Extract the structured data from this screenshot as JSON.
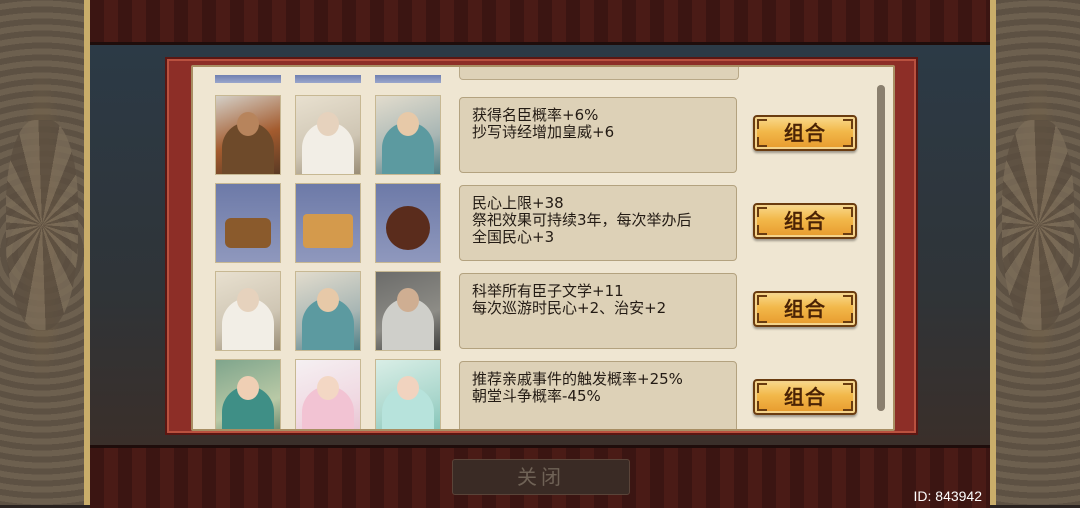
{
  "dialog": {
    "rows": [
      {
        "portraits": [
          "warrior-general-icon",
          "white-haired-sage-icon",
          "young-scholar-official-icon"
        ],
        "description": "获得名臣概率+6%\n抄写诗经增加皇威+6",
        "button": "组合"
      },
      {
        "portraits": [
          "treasure-cart-icon",
          "gold-ingots-icon",
          "wine-jar-icon"
        ],
        "description": "民心上限+38\n祭祀效果可持续3年，每次举办后\n全国民心+3",
        "button": "组合"
      },
      {
        "portraits": [
          "white-haired-sage-icon",
          "young-scholar-official-icon",
          "elder-minister-icon"
        ],
        "description": "科举所有臣子文学+11\n每次巡游时民心+2、治安+2",
        "button": "组合"
      },
      {
        "portraits": [
          "consort-lady-icon",
          "pink-dress-maiden-icon",
          "green-dress-maiden-icon"
        ],
        "description": "推荐亲戚事件的触发概率+25%\n朝堂斗争概率-45%",
        "button": "组合"
      }
    ]
  },
  "footer": {
    "close_label": "关闭",
    "id_text": "ID: 843942"
  }
}
